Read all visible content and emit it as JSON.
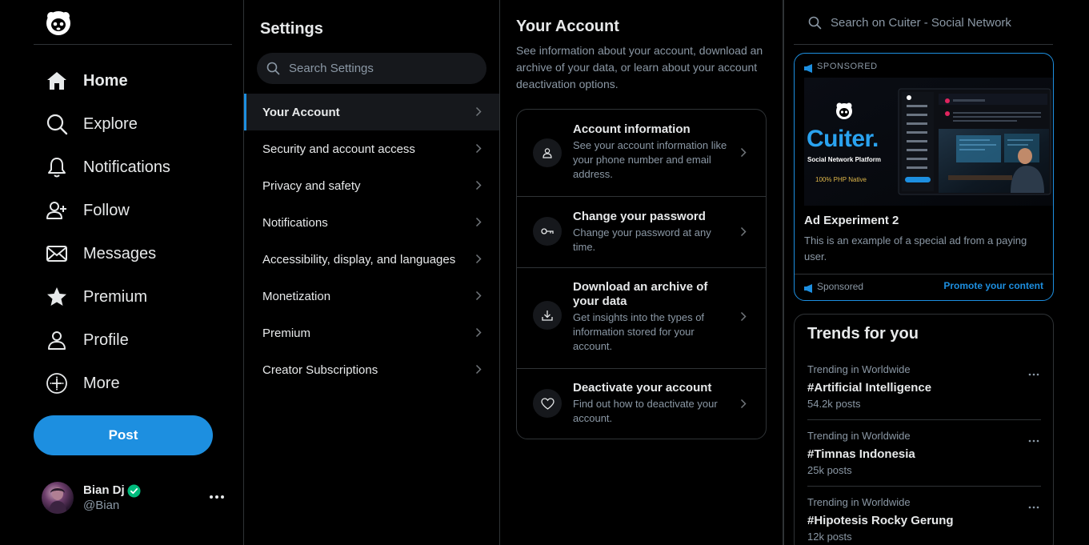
{
  "nav": {
    "items": [
      {
        "label": "Home",
        "icon": "home-icon",
        "active": true
      },
      {
        "label": "Explore",
        "icon": "search-icon"
      },
      {
        "label": "Notifications",
        "icon": "bell-icon"
      },
      {
        "label": "Follow",
        "icon": "user-plus-icon"
      },
      {
        "label": "Messages",
        "icon": "envelope-icon"
      },
      {
        "label": "Premium",
        "icon": "star-icon"
      },
      {
        "label": "Profile",
        "icon": "user-icon"
      },
      {
        "label": "More",
        "icon": "plus-circle-icon"
      }
    ],
    "post_label": "Post"
  },
  "account": {
    "name": "Bian Dj",
    "handle": "@Bian",
    "verified": true
  },
  "settings": {
    "title": "Settings",
    "search_placeholder": "Search Settings",
    "items": [
      {
        "label": "Your Account",
        "active": true
      },
      {
        "label": "Security and account access"
      },
      {
        "label": "Privacy and safety"
      },
      {
        "label": "Notifications"
      },
      {
        "label": "Accessibility, display, and languages"
      },
      {
        "label": "Monetization"
      },
      {
        "label": "Premium"
      },
      {
        "label": "Creator Subscriptions"
      }
    ]
  },
  "your_account": {
    "title": "Your Account",
    "description": "See information about your account, download an archive of your data, or learn about your account deactivation options.",
    "rows": [
      {
        "title": "Account information",
        "desc": "See your account information like your phone number and email address.",
        "icon": "user-icon"
      },
      {
        "title": "Change your password",
        "desc": "Change your password at any time.",
        "icon": "key-icon"
      },
      {
        "title": "Download an archive of your data",
        "desc": "Get insights into the types of information stored for your account.",
        "icon": "download-icon"
      },
      {
        "title": "Deactivate your account",
        "desc": "Find out how to deactivate your account.",
        "icon": "heart-icon"
      }
    ]
  },
  "right": {
    "search_placeholder": "Search on Cuiter - Social Network",
    "ad": {
      "sponsored_top": "SPONSORED",
      "image": {
        "brand": "Cuiter.",
        "tagline": "Social Network Platform",
        "note": "100% PHP Native"
      },
      "title": "Ad Experiment 2",
      "desc": "This is an example of a special ad from a paying user.",
      "sponsored_bottom": "Sponsored",
      "promote_label": "Promote your content"
    },
    "trends": {
      "title": "Trends for you",
      "items": [
        {
          "category": "Trending in Worldwide",
          "name": "#Artificial Intelligence",
          "posts": "54.2k posts"
        },
        {
          "category": "Trending in Worldwide",
          "name": "#Timnas Indonesia",
          "posts": "25k posts"
        },
        {
          "category": "Trending in Worldwide",
          "name": "#Hipotesis Rocky Gerung",
          "posts": "12k posts"
        }
      ]
    }
  },
  "colors": {
    "accent": "#1d8fe0",
    "verified": "#00ba7c",
    "background": "#000000",
    "border": "#2f3336",
    "muted_text": "#8b98a5"
  }
}
